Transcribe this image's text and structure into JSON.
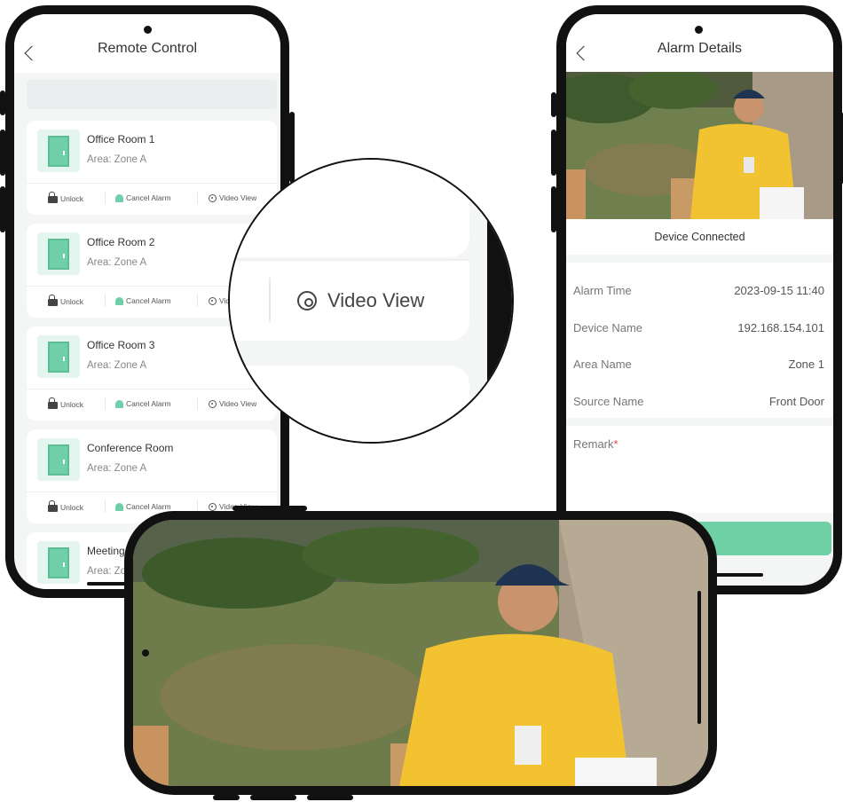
{
  "remote_control": {
    "title": "Remote Control",
    "rooms": [
      {
        "name": "Office Room 1",
        "area": "Area: Zone A"
      },
      {
        "name": "Office Room 2",
        "area": "Area: Zone A"
      },
      {
        "name": "Office Room 3",
        "area": "Area: Zone A"
      },
      {
        "name": "Conference Room",
        "area": "Area: Zone A"
      },
      {
        "name": "Meeting R",
        "area": "Area: Zone"
      }
    ],
    "actions": {
      "unlock": "Unlock",
      "cancel_alarm": "Cancel Alarm",
      "video_view": "Video View",
      "video_view_cut": "Vid"
    }
  },
  "magnifier": {
    "label": "Video View"
  },
  "alarm_details": {
    "title": "Alarm Details",
    "status": "Device Connected",
    "fields": [
      {
        "label": "Alarm Time",
        "value": "2023-09-15 11:40"
      },
      {
        "label": "Device Name",
        "value": "192.168.154.101"
      },
      {
        "label": "Area Name",
        "value": "Zone 1"
      },
      {
        "label": "Source Name",
        "value": "Front Door"
      }
    ],
    "remark_label": "Remark",
    "remark_required": "*",
    "confirm_label": "m"
  },
  "colors": {
    "accent": "#6fd0a6",
    "door_tile": "#e4f4ee",
    "phone_frame": "#111111",
    "screen_bg": "#f4f6f6"
  }
}
